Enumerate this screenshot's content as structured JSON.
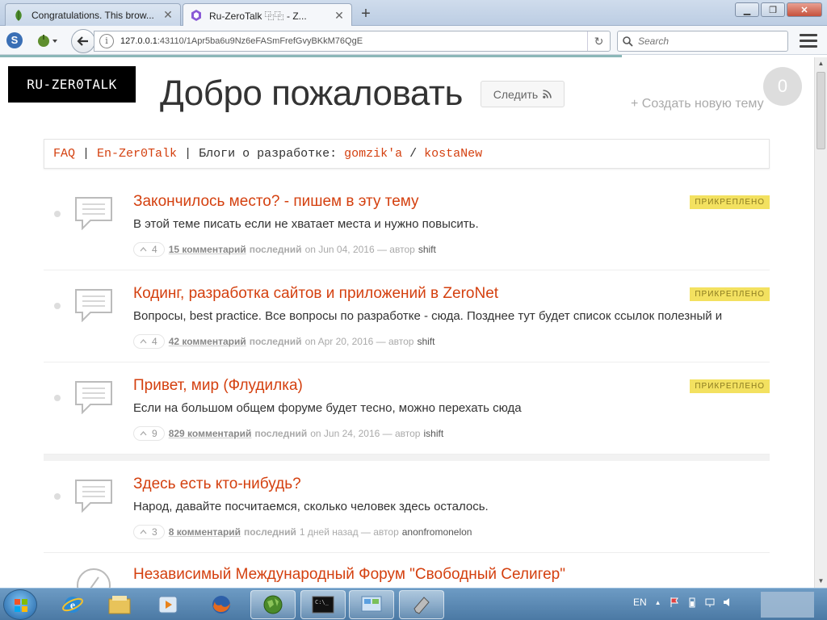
{
  "browser": {
    "tabs": [
      {
        "title": "Congratulations. This brow...",
        "active": false
      },
      {
        "title": "Ru-ZeroTalk ⿻⿻ - Z...",
        "active": true
      }
    ],
    "new_tab_symbol": "+",
    "url_host": "127.0.0.1",
    "url_rest": ":43110/1Apr5ba6u9Nz6eFASmFrefGvyBKkM76QgE",
    "search_placeholder": "Search",
    "window_buttons": {
      "minimize": "▁",
      "maximize": "❐",
      "close": "✕"
    }
  },
  "header": {
    "logo": "RU-ZER0TALK",
    "welcome": "Добро пожаловать",
    "follow_label": "Следить",
    "user_count": "0",
    "new_topic": "+ Создать новую тему"
  },
  "links": {
    "faq": "FAQ",
    "sep1": " | ",
    "en": "En-Zer0Talk",
    "sep2": " | Блоги о разработке: ",
    "gomzik": "gomzik'a",
    "sep3": " / ",
    "kosta": "kostaNew"
  },
  "topics": [
    {
      "title": "Закончилось место? - пишем в эту тему",
      "desc": "В этой теме писать если не хватает места и нужно повысить.",
      "votes": "4",
      "comments": "15 комментарий",
      "last_label": "последний",
      "date": "on Jun 04, 2016 — автор",
      "author": "shift",
      "badge": "ПРИКРЕПЛЕНО"
    },
    {
      "title": "Кодинг, разработка сайтов и приложений в ZeroNet",
      "desc": "Вопросы, best practice. Все вопросы по разработке - сюда. Позднее тут будет список ссылок полезный и",
      "votes": "4",
      "comments": "42 комментарий",
      "last_label": "последний",
      "date": "on Apr 20, 2016 — автор",
      "author": "shift",
      "badge": "ПРИКРЕПЛЕНО"
    },
    {
      "title": "Привет, мир (Флудилка)",
      "desc": "Если на большом общем форуме будет тесно, можно перехать сюда",
      "votes": "9",
      "comments": "829 комментарий",
      "last_label": "последний",
      "date": "on Jun 24, 2016 — автор",
      "author": "ishift",
      "badge": "ПРИКРЕПЛЕНО"
    },
    {
      "title": "Здесь есть кто-нибудь?",
      "desc": "Народ, давайте посчитаемся, сколько человек здесь осталось.",
      "votes": "3",
      "comments": "8 комментарий",
      "last_label": "последний",
      "date": "1 дней назад — автор",
      "author": "anonfromonelon",
      "badge": ""
    },
    {
      "title": "Независимый Международный Форум \"Свободный Селигер\"",
      "desc": "",
      "votes": "",
      "comments": "",
      "last_label": "",
      "date": "",
      "author": "",
      "badge": ""
    }
  ],
  "taskbar": {
    "language": "EN"
  },
  "colors": {
    "accent": "#d4400f",
    "pinned_bg": "#f3e160"
  }
}
